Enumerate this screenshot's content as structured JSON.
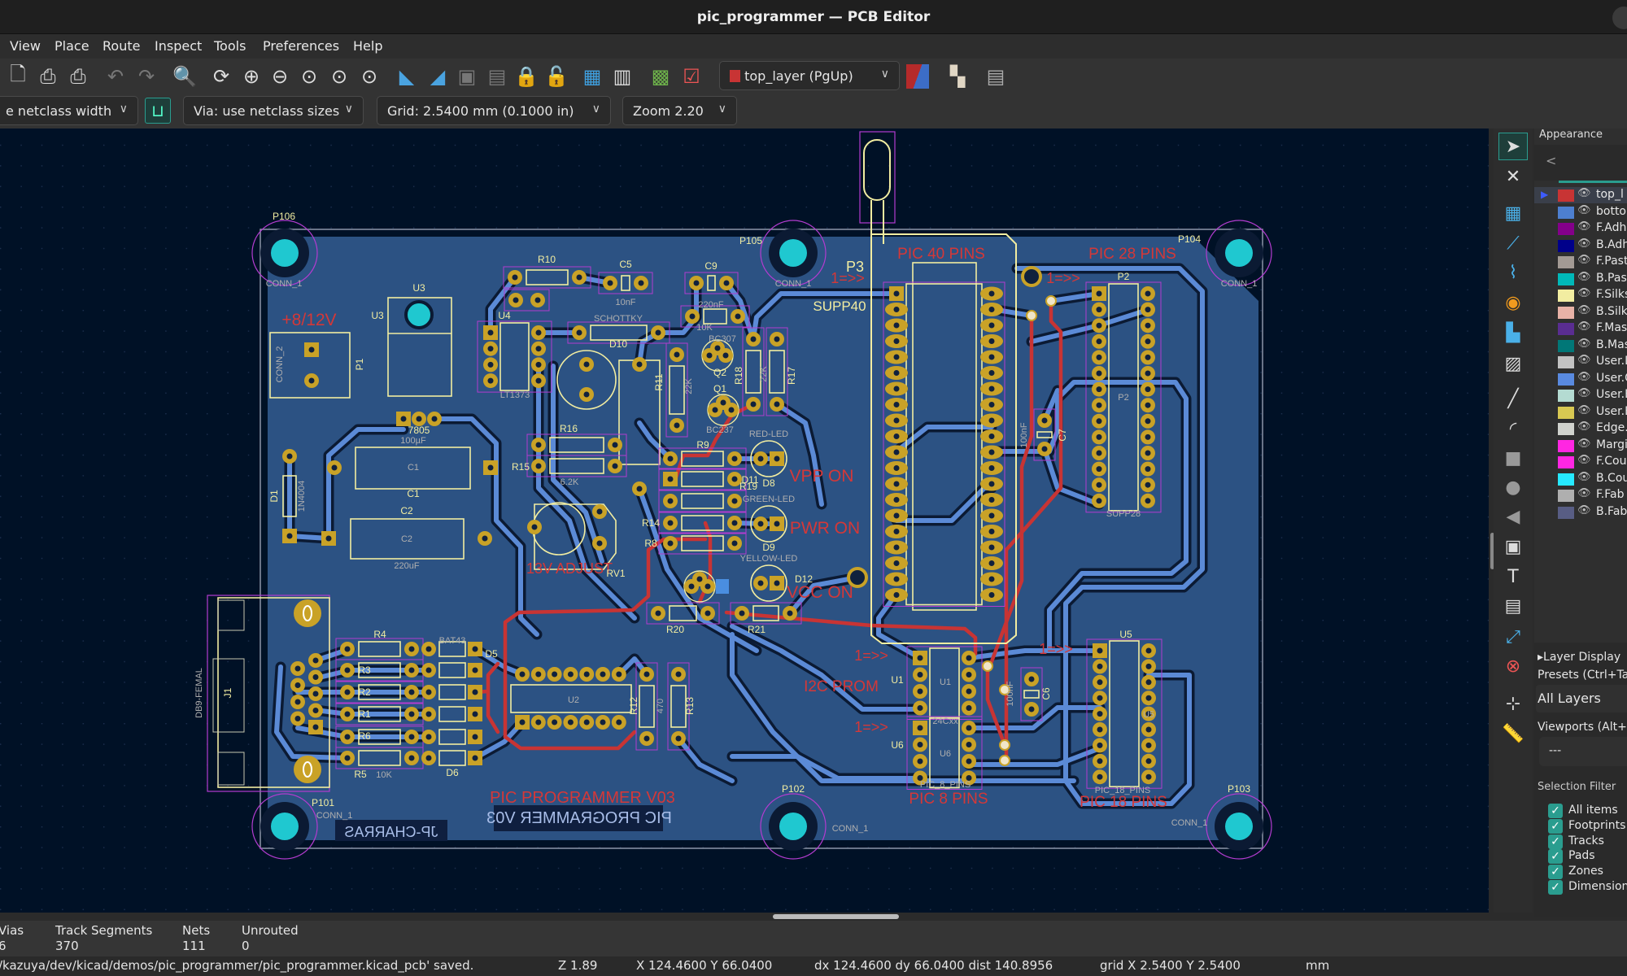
{
  "window": {
    "title": "pic_programmer — PCB Editor"
  },
  "menu": [
    "View",
    "Place",
    "Route",
    "Inspect",
    "Tools",
    "Preferences",
    "Help"
  ],
  "toolbar": {
    "icons": [
      "new-board-icon",
      "print-icon",
      "plot-icon",
      "undo-icon",
      "redo-icon",
      "find-icon",
      "redraw-icon",
      "zoom-in-icon",
      "zoom-out-icon",
      "zoom-fit-icon",
      "zoom-objects-icon",
      "zoom-selection-icon",
      "rotate-ccw-icon",
      "rotate-cw-icon",
      "group-icon",
      "ungroup-icon",
      "lock-icon",
      "unlock-icon",
      "footprint-editor-icon",
      "footprint-browser-icon",
      "update-pcb-icon",
      "drc-icon",
      "layer-pair-icon",
      "router-icon",
      "scripting-console-icon"
    ],
    "layer_select": "top_layer (PgUp)",
    "layer_color": "#c83434"
  },
  "toolbar2": {
    "track_width": "e netclass width",
    "via": "Via: use netclass sizes",
    "grid": "Grid: 2.5400 mm (0.1000 in)",
    "zoom": "Zoom 2.20"
  },
  "appearance": {
    "title": "Appearance",
    "back": "<",
    "layers": [
      {
        "name": "top_l",
        "color": "#c83434",
        "active": true
      },
      {
        "name": "botto",
        "color": "#4d7fd0"
      },
      {
        "name": "F.Adh",
        "color": "#84008a"
      },
      {
        "name": "B.Adh",
        "color": "#00008a"
      },
      {
        "name": "F.Past",
        "color": "#a39a94"
      },
      {
        "name": "B.Pas",
        "color": "#00b8b8"
      },
      {
        "name": "F.Silks",
        "color": "#f2eda1"
      },
      {
        "name": "B.Silk",
        "color": "#e8b2a7"
      },
      {
        "name": "F.Mas",
        "color": "#5a2d91"
      },
      {
        "name": "B.Mas",
        "color": "#017777"
      },
      {
        "name": "User.D",
        "color": "#c2c2c2"
      },
      {
        "name": "User.C",
        "color": "#598ae0"
      },
      {
        "name": "User.E",
        "color": "#b4dbd2"
      },
      {
        "name": "User.E",
        "color": "#d8c852"
      },
      {
        "name": "Edge.",
        "color": "#d0d2cd"
      },
      {
        "name": "Margi",
        "color": "#ff26e2"
      },
      {
        "name": "F.Cou",
        "color": "#ff26e2"
      },
      {
        "name": "B.Cou",
        "color": "#26e9ff"
      },
      {
        "name": "F.Fab",
        "color": "#afafaf"
      },
      {
        "name": "B.Fab",
        "color": "#585d84"
      }
    ],
    "layer_display": "Layer Display",
    "presets_label": "Presets (Ctrl+Ta",
    "preset_value": "All Layers",
    "viewports_label": "Viewports (Alt+",
    "viewport_value": "---",
    "selection_filter": "Selection Filter",
    "filters": [
      {
        "label": "All items",
        "checked": true
      },
      {
        "label": "Footprints",
        "checked": true
      },
      {
        "label": "Tracks",
        "checked": true
      },
      {
        "label": "Pads",
        "checked": true
      },
      {
        "label": "Zones",
        "checked": true
      },
      {
        "label": "Dimensions",
        "checked": true
      }
    ]
  },
  "info": {
    "headers": [
      "Vias",
      "Track Segments",
      "Nets",
      "Unrouted"
    ],
    "values": [
      "6",
      "370",
      "111",
      "0"
    ]
  },
  "status": {
    "message": "/kazuya/dev/kicad/demos/pic_programmer/pic_programmer.kicad_pcb' saved.",
    "zoom": "Z 1.89",
    "cursor": "X 124.4600  Y 66.0400",
    "delta": "dx 124.4600  dy 66.0400  dist 140.8956",
    "grid": "grid X 2.5400  Y 2.5400",
    "units": "mm"
  },
  "colors": {
    "board": "#2c5283",
    "track_top": "#c83434",
    "track_bottom": "#5b8ad6",
    "pad": "#c9a227",
    "silk": "#f2eda1",
    "fab": "#afafaf",
    "courtyard": "#b23ccf",
    "hole": "#1fc8d0",
    "canvas": "#001126"
  },
  "board": {
    "labels": [
      "P106",
      "CONN_1",
      "P105",
      "CONN_1",
      "P104",
      "CONN_1",
      "P101",
      "CONN_1",
      "P102",
      "CONN_1",
      "P103",
      "CONN_1",
      "+8/12V",
      "U3",
      "U3",
      "7805",
      "100µF",
      "C1",
      "C1",
      "C2",
      "C2",
      "220uF",
      "P1",
      "CONN_2",
      "D1",
      "1N4004",
      "R10",
      "C5",
      "10nF",
      "C9",
      "220nF",
      "SCHOTTKY",
      "D10",
      "U4",
      "LT1373",
      "10K",
      "BC307",
      "Q2",
      "Q1",
      "BC237",
      "R11",
      "22K",
      "R18",
      "R17",
      "22K",
      "R16",
      "R15",
      "6.2K",
      "RED-LED",
      "D8",
      "VPP ON",
      "R19",
      "GREEN-LED",
      "D9",
      "PWR ON",
      "YELLOW-LED",
      "D12",
      "VCC ON",
      "R9",
      "R14",
      "R8",
      "D11",
      "13V ADJUST",
      "RV1",
      "R20",
      "R21",
      "P3",
      "1=>>",
      "SUPP40",
      "PIC 40 PINS",
      "PIC 28 PINS",
      "1=>>",
      "P2",
      "P2",
      "SUPP28",
      "C7",
      "100nF",
      "U5",
      "U5",
      "PIC_18_PINS",
      "PIC 18 PINS",
      "1=>>",
      "1=>>",
      "1=>>",
      "U1",
      "U1",
      "24Cxx",
      "U6",
      "U6",
      "PIC_8_PINS",
      "PIC 8 PINS",
      "I2C PROM",
      "C6",
      "100nF",
      "J1",
      "DB9-FEMAL",
      "R4",
      "R3",
      "R2",
      "R1",
      "R6",
      "R5",
      "10K",
      "BAT43",
      "D5",
      "D6",
      "U2",
      "R12",
      "R13",
      "470",
      "PIC PROGRAMMER V03",
      "PIC PROGRAMMER V03",
      "JP-CHARRAS"
    ]
  }
}
